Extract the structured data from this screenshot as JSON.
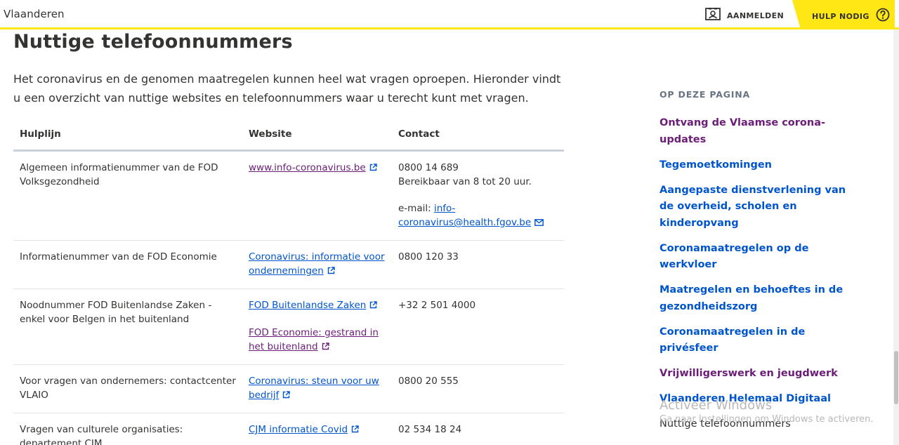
{
  "header": {
    "brand": "Vlaanderen",
    "login_label": "AANMELDEN",
    "help_label": "HULP NODIG",
    "accent_color": "#ffe615"
  },
  "main": {
    "title": "Nuttige telefoonnummers",
    "intro": "Het coronavirus en de genomen maatregelen kunnen heel wat vragen oproepen. Hieronder vindt u een overzicht van nuttige websites en telefoonnummers waar u terecht kunt met vragen.",
    "table": {
      "headers": [
        "Hulplijn",
        "Website",
        "Contact"
      ],
      "rows": [
        {
          "hulplijn": "Algemeen informatienummer van de FOD Volksgezondheid",
          "link1": "www.info-coronavirus.be",
          "link2": "",
          "contact": "0800 14 689",
          "contact_extra": "Bereikbaar van 8 tot 20 uur.",
          "email_label": "e-mail:",
          "email": "info-coronavirus@health.fgov.be"
        },
        {
          "hulplijn": "Informatienummer van de FOD Economie",
          "link1": "Coronavirus: informatie voor ondernemingen",
          "contact": "0800 120 33"
        },
        {
          "hulplijn": "Noodnummer FOD Buitenlandse Zaken - enkel voor Belgen in het buitenland",
          "link1": "FOD Buitenlandse Zaken",
          "link2": "FOD Economie: gestrand in het buitenland",
          "contact": "+32 2 501 4000"
        },
        {
          "hulplijn": "Voor vragen van ondernemers: contactcenter VLAIO",
          "link1": "Coronavirus: steun voor uw bedrijf",
          "contact": "0800 20 555"
        },
        {
          "hulplijn": "Vragen van culturele organisaties: departement CJM",
          "link1": "CJM informatie Covid",
          "contact": "02 534 18 24"
        }
      ]
    }
  },
  "sidebar": {
    "heading": "OP DEZE PAGINA",
    "items": [
      {
        "label": "Ontvang de Vlaamse corona-updates",
        "state": "visited"
      },
      {
        "label": "Tegemoetkomingen",
        "state": "link"
      },
      {
        "label": "Aangepaste dienstverlening van de overheid, scholen en kinderopvang",
        "state": "link"
      },
      {
        "label": "Coronamaatregelen op de werkvloer",
        "state": "link"
      },
      {
        "label": "Maatregelen en behoeftes in de gezondheidszorg",
        "state": "link"
      },
      {
        "label": "Coronamaatregelen in de privésfeer",
        "state": "link"
      },
      {
        "label": "Vrijwilligerswerk en jeugdwerk",
        "state": "visited"
      },
      {
        "label": "Vlaanderen Helemaal Digitaal",
        "state": "link"
      },
      {
        "label": "Nuttige telefoonnummers",
        "state": "current"
      }
    ]
  },
  "watermark": {
    "title": "Activeer Windows",
    "subtitle": "Ga naar Instellingen om Windows te activeren."
  },
  "colors": {
    "link": "#0055cc",
    "visited": "#6b1d78",
    "text": "#333332"
  }
}
